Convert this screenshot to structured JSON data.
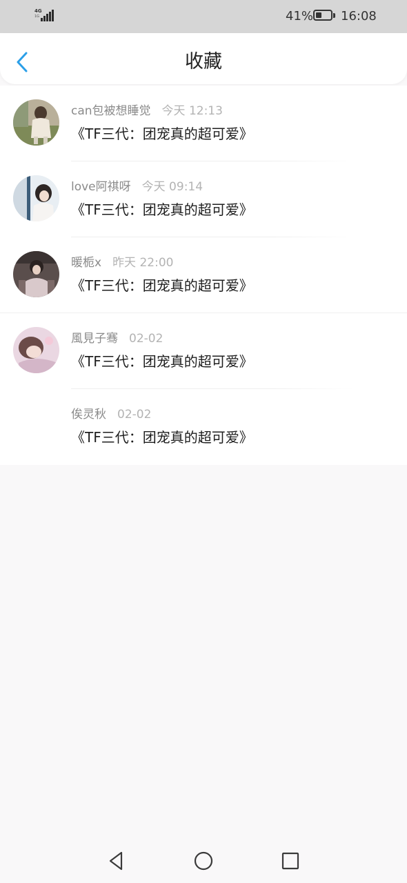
{
  "status_bar": {
    "network": "4G",
    "network_sub": "1G",
    "battery_percent": "41%",
    "battery_level": 0.41,
    "time": "16:08"
  },
  "header": {
    "title": "收藏",
    "back_icon": "chevron-left-icon",
    "accent_color": "#2b9fe8"
  },
  "favorites": [
    {
      "user": "can包被想睡觉",
      "time": "今天 12:13",
      "title": "《TF三代：团宠真的超可爱》",
      "has_avatar": true
    },
    {
      "user": "love阿祺呀",
      "time": "今天 09:14",
      "title": "《TF三代：团宠真的超可爱》",
      "has_avatar": true
    },
    {
      "user": "暖栀x",
      "time": "昨天 22:00",
      "title": "《TF三代：团宠真的超可爱》",
      "has_avatar": true
    },
    {
      "user": "風見子骞",
      "time": "02-02",
      "title": "《TF三代：团宠真的超可爱》",
      "has_avatar": true
    },
    {
      "user": "俟灵秋",
      "time": "02-02",
      "title": "《TF三代：团宠真的超可爱》",
      "has_avatar": false
    }
  ],
  "nav_bar": {
    "back_icon": "triangle-back-icon",
    "home_icon": "circle-home-icon",
    "recent_icon": "square-recent-icon"
  }
}
